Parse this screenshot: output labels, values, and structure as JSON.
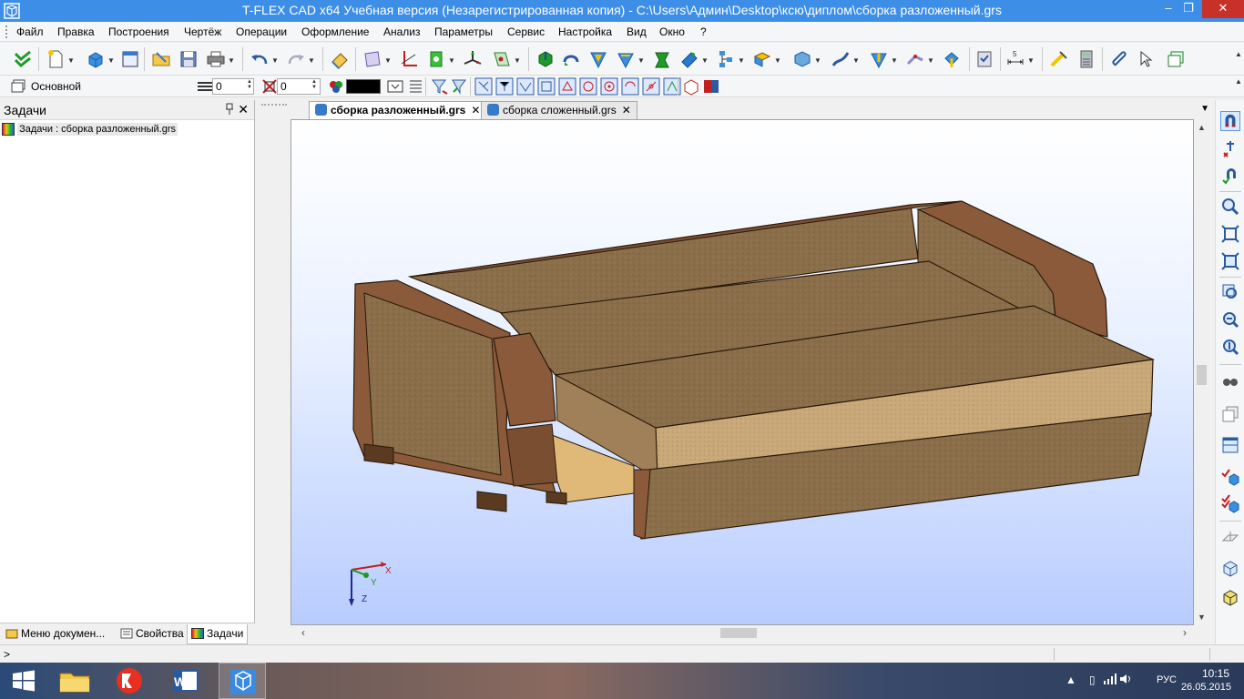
{
  "window": {
    "title": "T-FLEX CAD x64 Учебная версия (Незарегистрированная копия) - C:\\Users\\Админ\\Desktop\\ксю\\диплом\\сборка разложенный.grs",
    "minimize": "‒",
    "restore": "❐",
    "close": "✕"
  },
  "menu": {
    "items": [
      "Файл",
      "Правка",
      "Построения",
      "Чертёж",
      "Операции",
      "Оформление",
      "Анализ",
      "Параметры",
      "Сервис",
      "Настройка",
      "Вид",
      "Окно",
      "?"
    ]
  },
  "toolbar2": {
    "mode_label": "Основной",
    "layer_value": "0",
    "level_value": "0",
    "color_value": "#000000"
  },
  "left_panel": {
    "title": "Задачи",
    "pin": "📌",
    "close": "✕",
    "task_item": "Задачи : сборка разложенный.grs",
    "tabs": [
      "Меню докумен...",
      "Свойства",
      "Задачи"
    ]
  },
  "documents": {
    "tabs": [
      {
        "label": "сборка разложенный.grs",
        "active": true
      },
      {
        "label": "сборка сложенный.grs",
        "active": false
      }
    ],
    "tab_menu": "▼"
  },
  "axes": {
    "x": "X",
    "y": "Y",
    "z": "Z"
  },
  "statusbar": {
    "prompt": ">"
  },
  "taskbar": {
    "apps": [
      "start",
      "file-explorer",
      "yandex-browser",
      "word",
      "t-flex-cad"
    ],
    "lang": "РУС",
    "time": "10:15",
    "date": "26.05.2015"
  },
  "colors": {
    "titlebar": "#3c8ee6",
    "close_button": "#c7312a",
    "viewport_top": "#ffffff",
    "viewport_bottom": "#b8ccff",
    "sofa_fabric": "#8a6e4a",
    "sofa_frame": "#8a5a3a",
    "mattress": "#c8a878"
  }
}
